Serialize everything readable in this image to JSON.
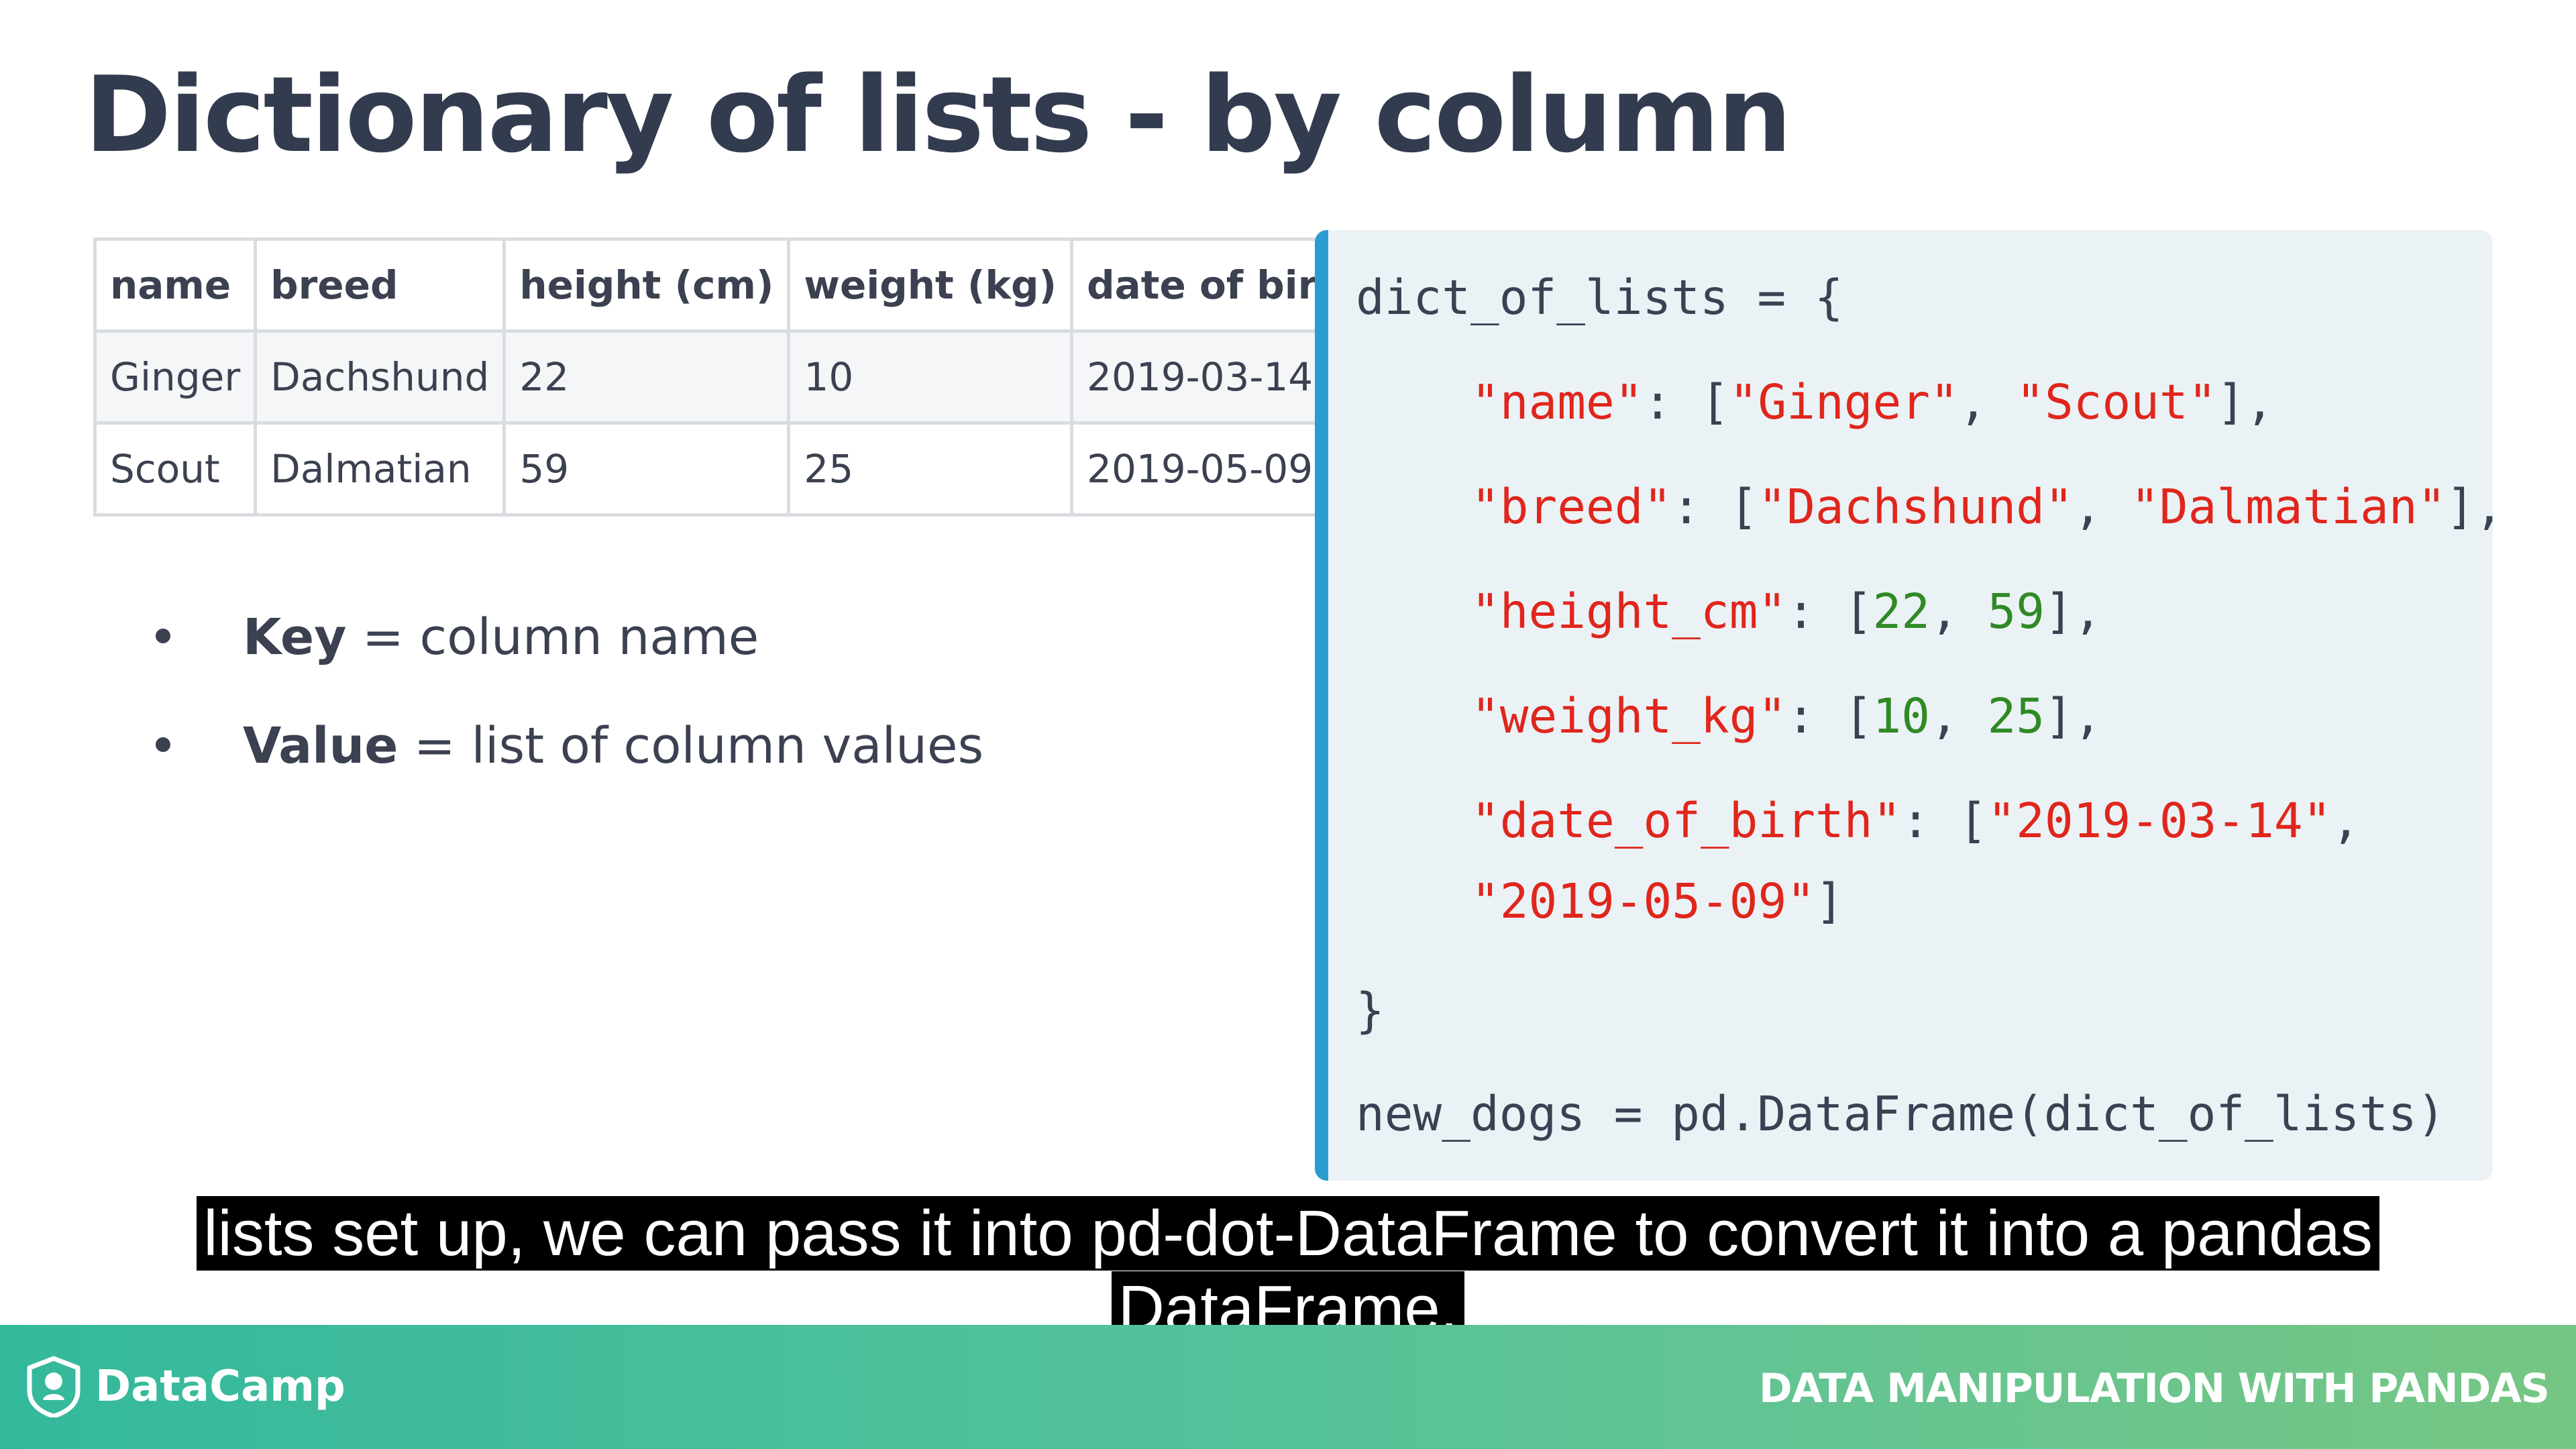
{
  "slide": {
    "title": "Dictionary of lists - by column"
  },
  "table": {
    "headers": [
      "name",
      "breed",
      "height (cm)",
      "weight (kg)",
      "date of birth"
    ],
    "rows": [
      [
        "Ginger",
        "Dachshund",
        "22",
        "10",
        "2019-03-14"
      ],
      [
        "Scout",
        "Dalmatian",
        "59",
        "25",
        "2019-05-09"
      ]
    ]
  },
  "bullets": [
    {
      "bold": "Key",
      "rest": " = column name"
    },
    {
      "bold": "Value",
      "rest": " = list of column values"
    }
  ],
  "code": {
    "line1": "dict_of_lists = {",
    "name_key": "\"name\"",
    "name_v1": "\"Ginger\"",
    "name_v2": "\"Scout\"",
    "breed_key": "\"breed\"",
    "breed_v1": "\"Dachshund\"",
    "breed_v2": "\"Dalmatian\"",
    "height_key": "\"height_cm\"",
    "height_v1": "22",
    "height_v2": "59",
    "weight_key": "\"weight_kg\"",
    "weight_v1": "10",
    "weight_v2": "25",
    "dob_key": "\"date_of_birth\"",
    "dob_v1": "\"2019-03-14\"",
    "dob_v2": "\"2019-05-09\"",
    "close": "}",
    "last_line": "new_dogs = pd.DataFrame(dict_of_lists)"
  },
  "caption": {
    "line1": "lists set up, we can pass it into pd-dot-DataFrame to convert it into a pandas",
    "line2": "DataFrame."
  },
  "footer": {
    "brand": "DataCamp",
    "course": "DATA MANIPULATION WITH PANDAS",
    "logo_icon": "datacamp-logo-icon"
  },
  "colors": {
    "title": "#333b4f",
    "code_string": "#e0261c",
    "code_number": "#2f8a24",
    "code_border": "#2c9cd0",
    "code_bg": "#ebf2f6",
    "footer_left": "#34b89c",
    "footer_right": "#76c684"
  }
}
